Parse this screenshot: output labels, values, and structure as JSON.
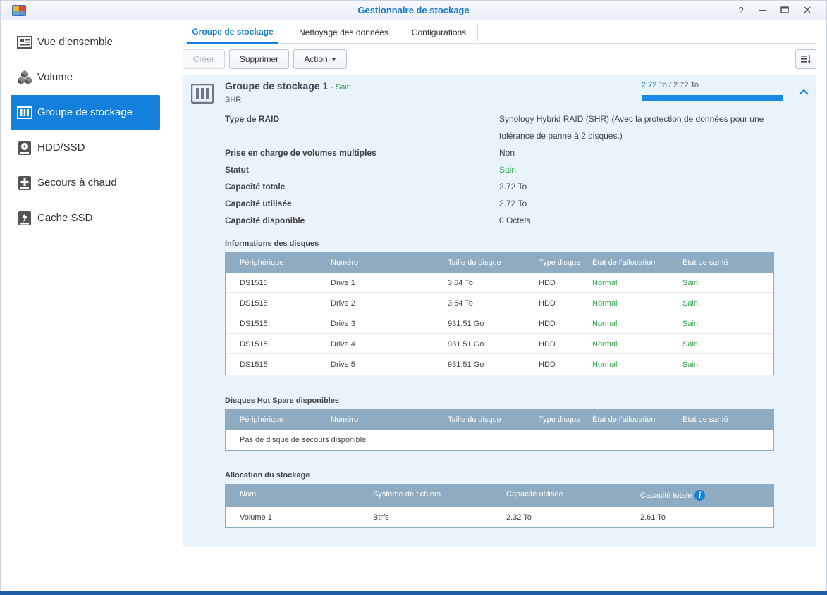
{
  "window": {
    "title": "Gestionnaire de stockage",
    "controls": [
      "help-icon",
      "minimize-icon",
      "maximize-icon",
      "close-icon"
    ]
  },
  "sidebar": {
    "items": [
      {
        "label": "Vue d’ensemble",
        "icon": "overview-icon",
        "active": false
      },
      {
        "label": "Volume",
        "icon": "volume-cubes-icon",
        "active": false
      },
      {
        "label": "Groupe de stockage",
        "icon": "storage-pool-icon",
        "active": true
      },
      {
        "label": "HDD/SSD",
        "icon": "hdd-icon",
        "active": false
      },
      {
        "label": "Secours à chaud",
        "icon": "hot-spare-icon",
        "active": false
      },
      {
        "label": "Cache SSD",
        "icon": "ssd-cache-icon",
        "active": false
      }
    ]
  },
  "tabs": [
    {
      "label": "Groupe de stockage",
      "active": true
    },
    {
      "label": "Nettoyage des données",
      "active": false
    },
    {
      "label": "Configurations",
      "active": false
    }
  ],
  "toolbar": {
    "create_label": "Créer",
    "delete_label": "Supprimer",
    "action_label": "Action"
  },
  "pool": {
    "name": "Groupe de stockage 1",
    "status": "- Sain",
    "type": "SHR",
    "capacity_used": "2.72 To",
    "capacity_separator": " / ",
    "capacity_total": "2.72 To",
    "usage_fraction": 1.0,
    "properties": [
      {
        "label": "Type de RAID",
        "value_line1": "Synology Hybrid RAID (SHR) (Avec la protection de données pour une",
        "value_line2": "tolérance de panne à 2 disques.)"
      },
      {
        "label": "Prise en charge de volumes multiples",
        "value": "Non"
      },
      {
        "label": "Statut",
        "value": "Sain"
      },
      {
        "label": "Capacité totale",
        "value": "2.72 To"
      },
      {
        "label": "Capacité utilisée",
        "value": "2.72 To"
      },
      {
        "label": "Capacité disponible",
        "value": "0 Octets"
      }
    ]
  },
  "disk_info": {
    "title": "Informations des disques",
    "columns": [
      "Périphérique",
      "Numéro",
      "Taille du disque",
      "Type disque",
      "État de l’allocation",
      "État de santé"
    ],
    "rows": [
      [
        "DS1515",
        "Drive 1",
        "3.64 To",
        "HDD",
        "Normal",
        "Sain"
      ],
      [
        "DS1515",
        "Drive 2",
        "3.64 To",
        "HDD",
        "Normal",
        "Sain"
      ],
      [
        "DS1515",
        "Drive 3",
        "931.51 Go",
        "HDD",
        "Normal",
        "Sain"
      ],
      [
        "DS1515",
        "Drive 4",
        "931.51 Go",
        "HDD",
        "Normal",
        "Sain"
      ],
      [
        "DS1515",
        "Drive 5",
        "931.51 Go",
        "HDD",
        "Normal",
        "Sain"
      ]
    ]
  },
  "hot_spare": {
    "title": "Disques Hot Spare disponibles",
    "columns": [
      "Périphérique",
      "Numéro",
      "Taille du disque",
      "Type disque",
      "État de l’allocation",
      "État de santé"
    ],
    "empty_text": "Pas de disque de secours disponible."
  },
  "allocation": {
    "title": "Allocation du stockage",
    "columns": [
      "Nom",
      "Système de fichiers",
      "Capacité utilisée",
      "Capacité totale"
    ],
    "info_icon": "i",
    "rows": [
      [
        "Volume 1",
        "Btrfs",
        "2.32 To",
        "2.61 To"
      ]
    ]
  },
  "colors": {
    "accent": "#1381db",
    "healthy": "#2ea64a",
    "grid_header": "#8fabc1",
    "panel_bg": "#e8f3fb"
  }
}
